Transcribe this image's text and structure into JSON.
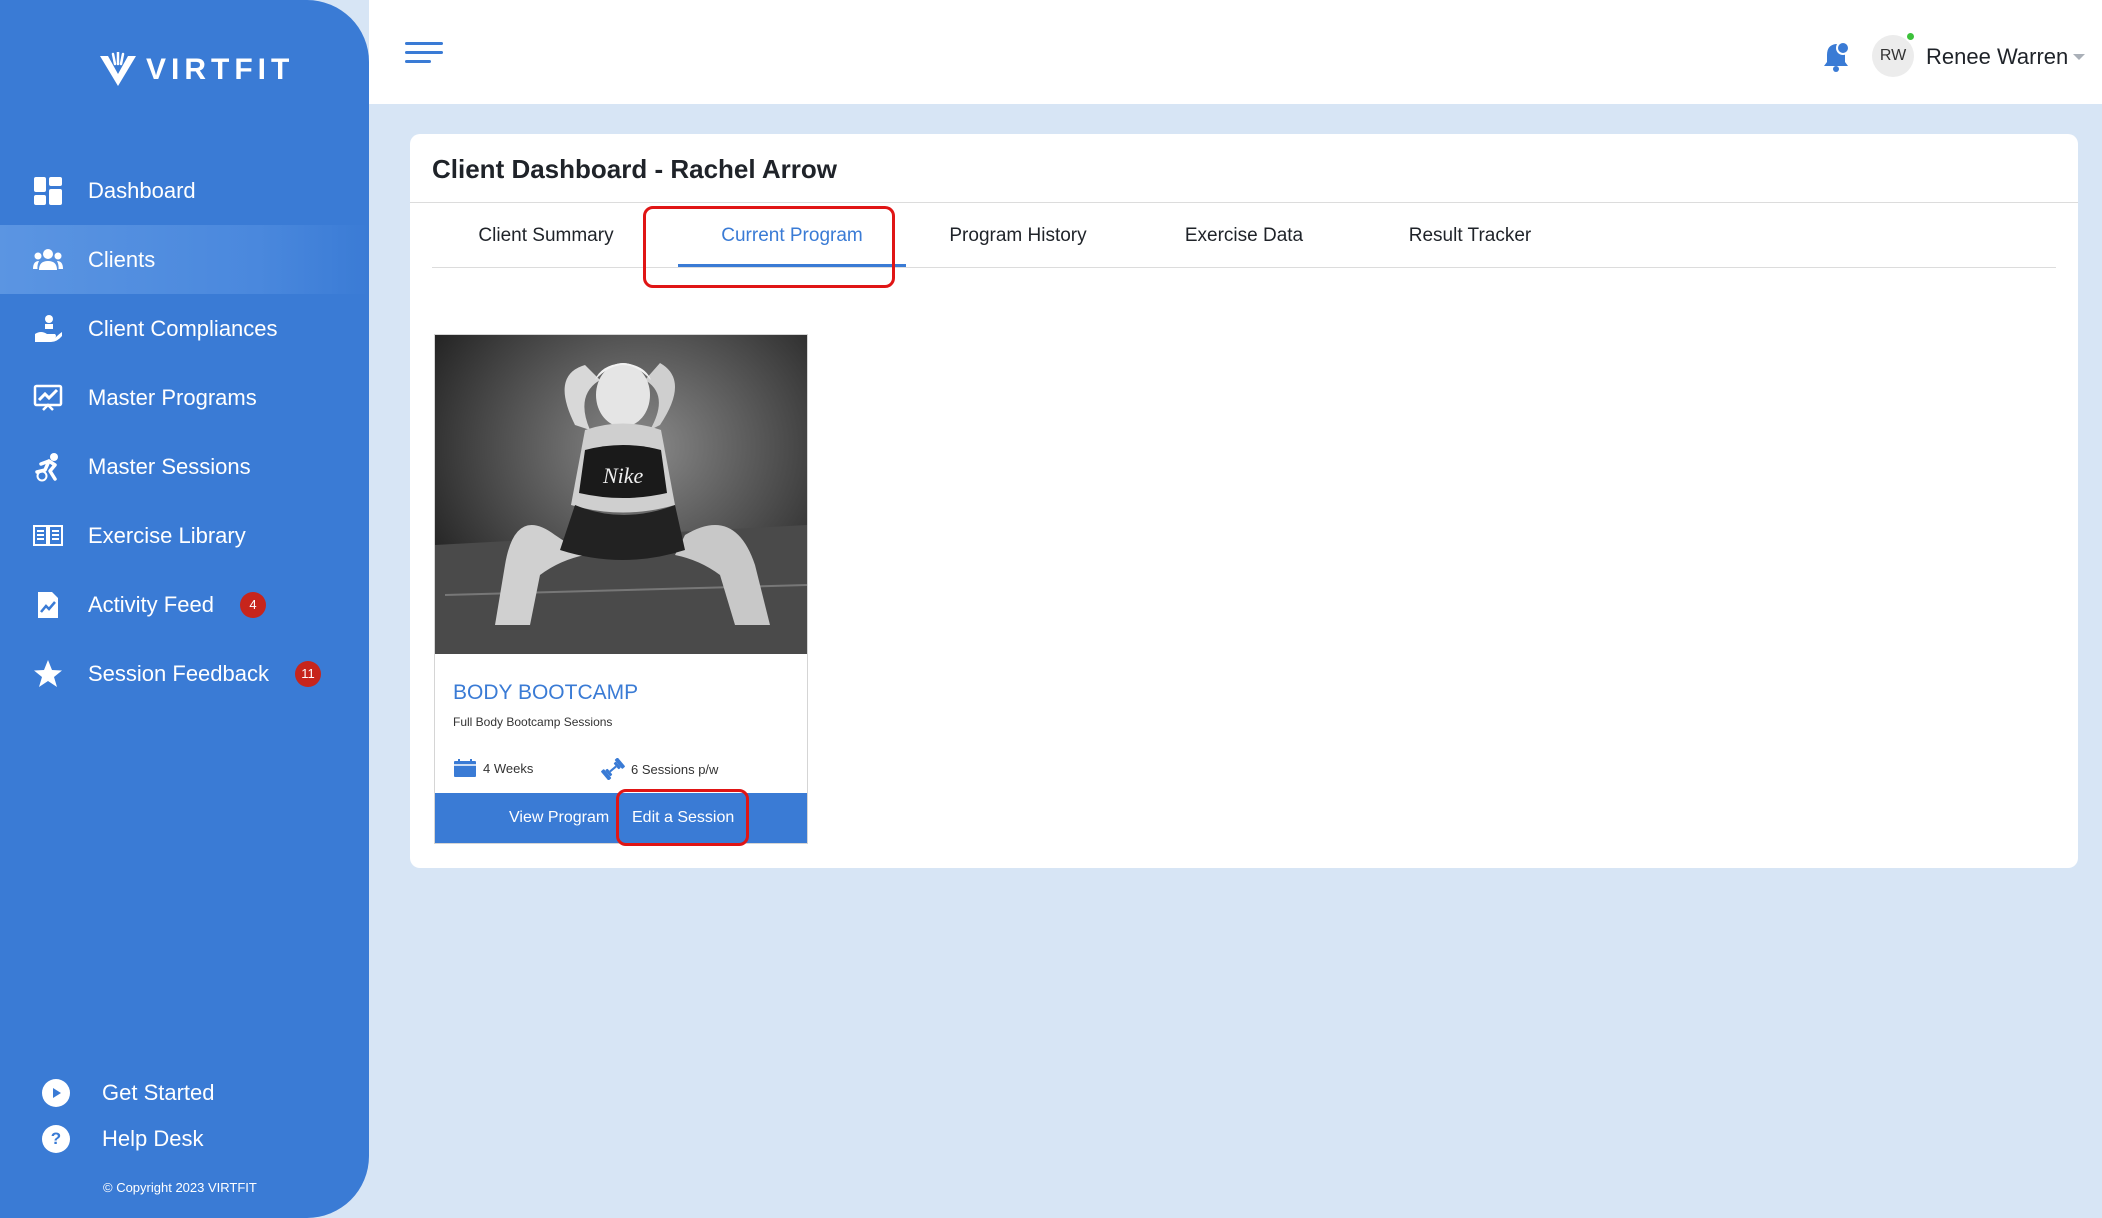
{
  "brand": {
    "name": "VIRTFIT"
  },
  "sidebar": {
    "items": [
      {
        "label": "Dashboard",
        "icon": "dashboard-icon"
      },
      {
        "label": "Clients",
        "icon": "users-icon",
        "active": true
      },
      {
        "label": "Client Compliances",
        "icon": "hand-heart-icon"
      },
      {
        "label": "Master Programs",
        "icon": "chart-board-icon"
      },
      {
        "label": "Master Sessions",
        "icon": "runner-icon"
      },
      {
        "label": "Exercise Library",
        "icon": "book-icon"
      },
      {
        "label": "Activity Feed",
        "icon": "feed-icon",
        "badge": "4"
      },
      {
        "label": "Session Feedback",
        "icon": "star-icon",
        "badge": "11"
      }
    ],
    "bottom": [
      {
        "label": "Get Started",
        "icon": "play-icon"
      },
      {
        "label": "Help Desk",
        "icon": "question-icon"
      }
    ],
    "copyright": "© Copyright 2023 VIRTFIT"
  },
  "header": {
    "user": {
      "initials": "RW",
      "name": "Renee Warren",
      "online": true
    },
    "icons": [
      "menu-icon",
      "bell-icon",
      "chevron-down-icon"
    ]
  },
  "page": {
    "title": "Client Dashboard - Rachel Arrow",
    "tabs": [
      {
        "label": "Client Summary"
      },
      {
        "label": "Current Program",
        "active": true
      },
      {
        "label": "Program History"
      },
      {
        "label": "Exercise Data"
      },
      {
        "label": "Result Tracker"
      }
    ]
  },
  "program_card": {
    "title": "BODY BOOTCAMP",
    "subtitle": "Full Body Bootcamp Sessions",
    "duration": "4 Weeks",
    "frequency": "6 Sessions p/w",
    "view_label": "View Program",
    "edit_label": "Edit a Session",
    "image_logo": "Nike"
  },
  "colors": {
    "primary": "#3a7bd5",
    "background": "#d7e5f5",
    "badge": "#c7251c",
    "highlight": "#e01515",
    "online": "#3cc13b"
  }
}
